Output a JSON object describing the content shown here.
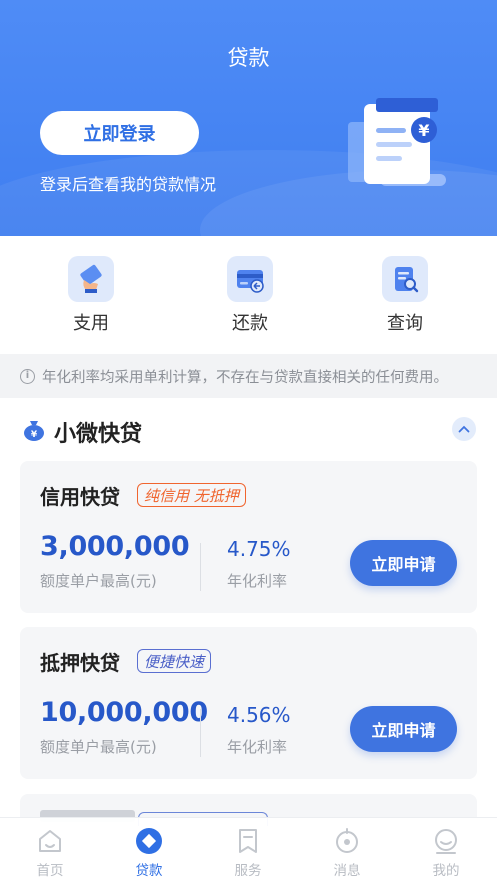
{
  "header": {
    "title": "贷款",
    "login_button": "立即登录",
    "login_subtitle": "登录后查看我的贷款情况"
  },
  "quick_actions": [
    {
      "label": "支用",
      "icon": "card-hand-icon"
    },
    {
      "label": "还款",
      "icon": "card-return-icon"
    },
    {
      "label": "查询",
      "icon": "search-document-icon"
    }
  ],
  "notice": "年化利率均采用单利计算，不存在与贷款直接相关的任何费用。",
  "section": {
    "title": "小微快贷"
  },
  "products": [
    {
      "name": "信用快贷",
      "tag": "纯信用 无抵押",
      "amount": "3,000,000",
      "amount_label": "额度单户最高(元)",
      "rate": "4.75%",
      "rate_label": "年化利率",
      "button": "立即申请"
    },
    {
      "name": "抵押快贷",
      "tag": "便捷快速",
      "amount": "10,000,000",
      "amount_label": "额度单户最高(元)",
      "rate": "4.56%",
      "rate_label": "年化利率",
      "button": "立即申请"
    }
  ],
  "tabs": [
    {
      "label": "首页",
      "icon": "home-icon",
      "active": false
    },
    {
      "label": "贷款",
      "icon": "loan-icon",
      "active": true
    },
    {
      "label": "服务",
      "icon": "service-icon",
      "active": false
    },
    {
      "label": "消息",
      "icon": "message-icon",
      "active": false
    },
    {
      "label": "我的",
      "icon": "profile-icon",
      "active": false
    }
  ],
  "colors": {
    "primary": "#3f74e0",
    "header": "#4f8cf6",
    "orange_tag": "#f0652f",
    "blue_tag": "#4a5fc7"
  }
}
